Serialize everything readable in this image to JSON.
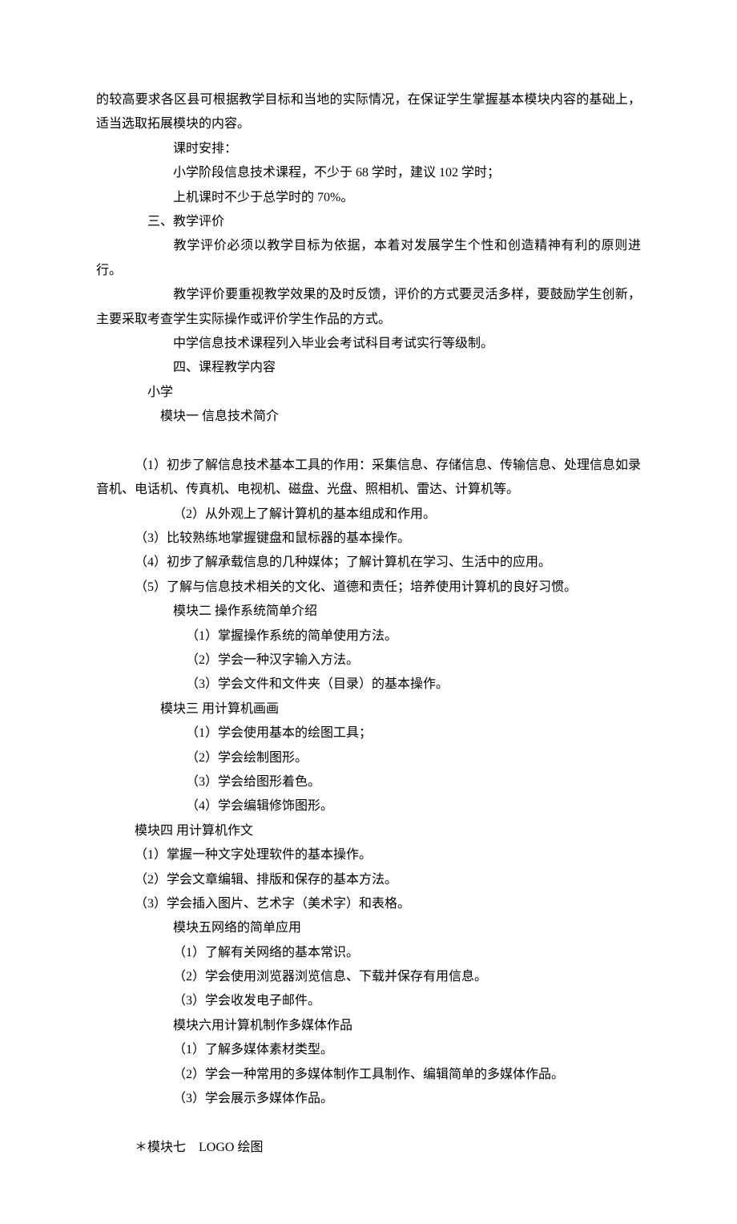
{
  "para1": "的较高要求各区县可根据教学目标和当地的实际情况，在保证学生掌握基本模块内容的基础上，适当选取拓展模块的内容。",
  "para2": "课时安排：",
  "para3": "小学阶段信息技术课程，不少于 68 学时，建议 102 学时；",
  "para4": "上机课时不少于总学时的 70%。",
  "para5": "三、教学评价",
  "para6": "教学评价必须以教学目标为依据，本着对发展学生个性和创造精神有利的原则进行。",
  "para7": "教学评价要重视教学效果的及时反馈，评价的方式要灵活多样，要鼓励学生创新，主要采取考查学生实际操作或评价学生作品的方式。",
  "para8": "中学信息技术课程列入毕业会考试科目考试实行等级制。",
  "para9": "四、课程教学内容",
  "para10": "小学",
  "para11": "模块一  信息技术简介",
  "para12": "（1）初步了解信息技术基本工具的作用：采集信息、存储信息、传输信息、处理信息如录音机、电话机、传真机、电视机、磁盘、光盘、照相机、雷达、计算机等。",
  "para13": "（2）从外观上了解计算机的基本组成和作用。",
  "para14": "（3）比较熟练地掌握键盘和鼠标器的基本操作。",
  "para15": "（4）初步了解承载信息的几种媒体；了解计算机在学习、生活中的应用。",
  "para16": "（5）了解与信息技术相关的文化、道德和责任；培养使用计算机的良好习惯。",
  "para17": "模块二  操作系统简单介绍",
  "para18": "（1）掌握操作系统的简单使用方法。",
  "para19": "（2）学会一种汉字输入方法。",
  "para20": "（3）学会文件和文件夹（目录）的基本操作。",
  "para21": "模块三  用计算机画画",
  "para22": "（1）学会使用基本的绘图工具；",
  "para23": "（2）学会绘制图形。",
  "para24": "（3）学会给图形着色。",
  "para25": "（4）学会编辑修饰图形。",
  "para26": "模块四 用计算机作文",
  "para27": "（1）掌握一种文字处理软件的基本操作。",
  "para28": "（2）学会文章编辑、排版和保存的基本方法。",
  "para29": "（3）学会插入图片、艺术字（美术字）和表格。",
  "para30": "模块五网络的简单应用",
  "para31": "（1）了解有关网络的基本常识。",
  "para32": "（2）学会使用浏览器浏览信息、下载并保存有用信息。",
  "para33": "（3）学会收发电子邮件。",
  "para34": "模块六用计算机制作多媒体作品",
  "para35": "（1）了解多媒体素材类型。",
  "para36": "（2）学会一种常用的多媒体制作工具制作、编辑简单的多媒体作品。",
  "para37": "（3）学会展示多媒体作品。",
  "para38": "＊模块七　LOGO 绘图"
}
